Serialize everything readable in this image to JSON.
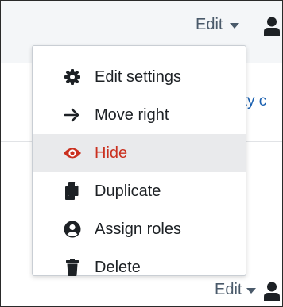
{
  "header": {
    "edit_label": "Edit"
  },
  "background": {
    "link_text": "vity c",
    "edit_label_bottom": "Edit"
  },
  "menu": {
    "items": [
      {
        "label": "Edit settings",
        "icon": "gear-icon"
      },
      {
        "label": "Move right",
        "icon": "arrow-right-icon"
      },
      {
        "label": "Hide",
        "icon": "eye-icon",
        "state": "hover"
      },
      {
        "label": "Duplicate",
        "icon": "copy-icon"
      },
      {
        "label": "Assign roles",
        "icon": "user-circle-icon"
      },
      {
        "label": "Delete",
        "icon": "trash-icon"
      }
    ]
  },
  "colors": {
    "text": "#1d2125",
    "muted": "#4a5a6a",
    "danger": "#ca3120",
    "link": "#1a60b0",
    "hover_bg": "#e9eaec",
    "header_bg": "#f4f6f8"
  }
}
